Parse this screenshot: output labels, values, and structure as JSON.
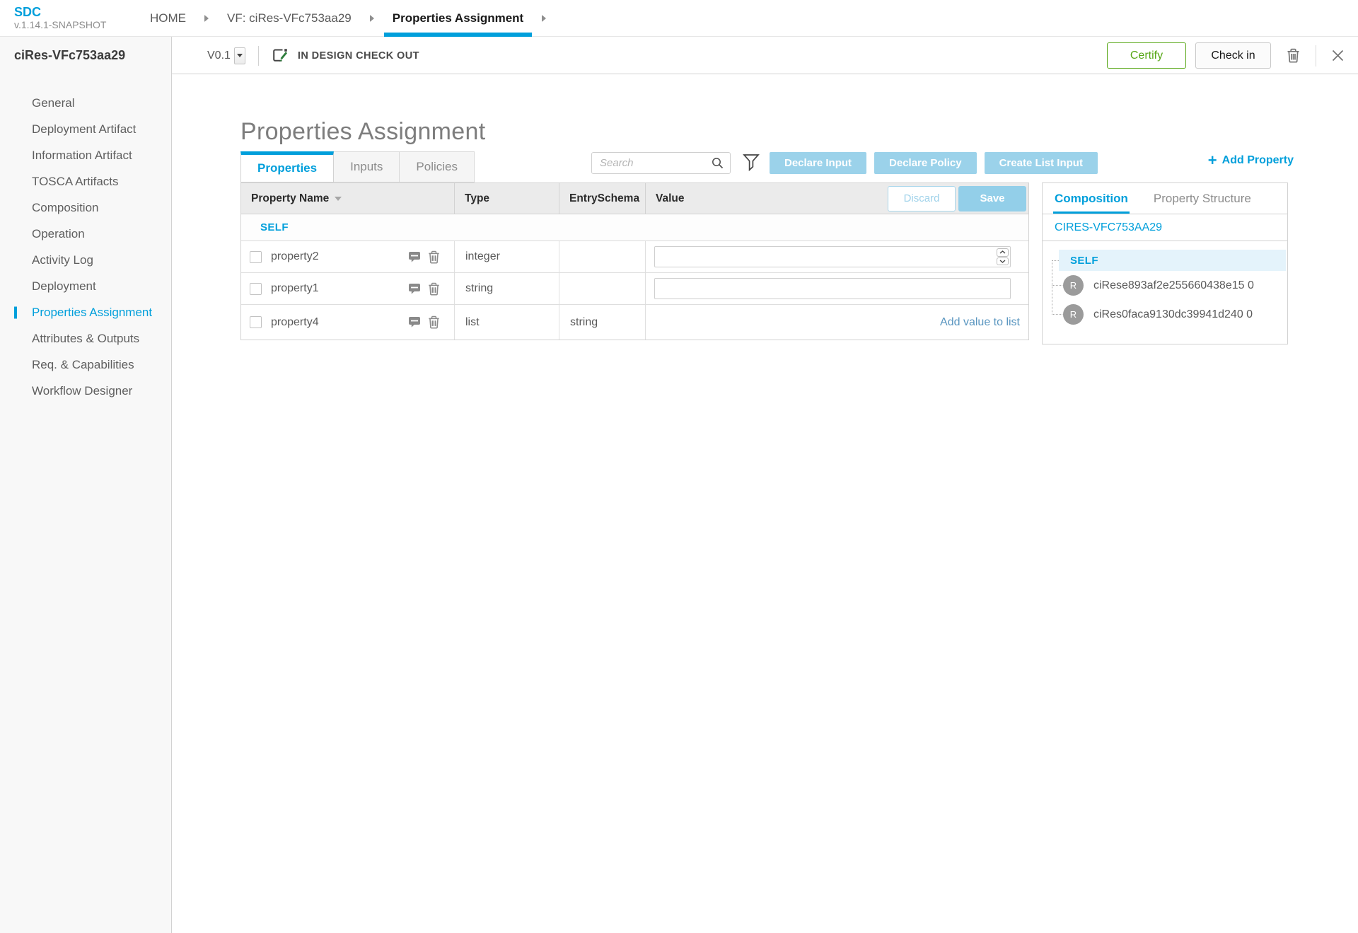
{
  "app": {
    "name": "SDC",
    "version": "v.1.14.1-SNAPSHOT"
  },
  "breadcrumb": {
    "items": [
      "HOME",
      "VF: ciRes-VFc753aa29",
      "Properties Assignment"
    ]
  },
  "workspace": {
    "component_name": "ciRes-VFc753aa29",
    "version": "V0.1",
    "state": "IN DESIGN CHECK OUT",
    "certify_label": "Certify",
    "check_in_label": "Check in"
  },
  "sidebar": {
    "active": "Properties Assignment",
    "items": [
      "General",
      "Deployment Artifact",
      "Information Artifact",
      "TOSCA Artifacts",
      "Composition",
      "Operation",
      "Activity Log",
      "Deployment",
      "Properties Assignment",
      "Attributes & Outputs",
      "Req. & Capabilities",
      "Workflow Designer"
    ]
  },
  "main": {
    "title": "Properties Assignment",
    "tabs": [
      "Properties",
      "Inputs",
      "Policies"
    ],
    "active_tab": "Properties",
    "search": {
      "placeholder": "Search",
      "value": ""
    },
    "actions": [
      "Declare Input",
      "Declare Policy",
      "Create List Input"
    ],
    "add_property": {
      "plus": "+",
      "label": "Add Property"
    },
    "table": {
      "columns": [
        "Property Name",
        "Type",
        "EntrySchema",
        "Value"
      ],
      "discard_label": "Discard",
      "save_label": "Save",
      "group_label": "SELF",
      "rows": [
        {
          "name": "property2",
          "type": "integer",
          "entry_schema": "",
          "value": "",
          "value_control": "number-input"
        },
        {
          "name": "property1",
          "type": "string",
          "entry_schema": "",
          "value": "",
          "value_control": "text-input"
        },
        {
          "name": "property4",
          "type": "list",
          "entry_schema": "string",
          "value_link": "Add value to list",
          "value_control": "link"
        }
      ]
    }
  },
  "composition_panel": {
    "tabs": [
      "Composition",
      "Property Structure"
    ],
    "active_tab": "Composition",
    "component": "CIRES-VFC753AA29",
    "tree": {
      "root": "SELF",
      "children": [
        {
          "avatar": "R",
          "label": "ciRese893af2e255660438e15 0"
        },
        {
          "avatar": "R",
          "label": "ciRes0faca9130dc39941d240 0"
        }
      ]
    }
  },
  "colors": {
    "accent": "#009fdb",
    "light_blue_button": "#9bd2ea",
    "certify_green": "#57a716",
    "selected_node_bg": "#e4f3fb",
    "avatar_gray": "#9b9b9b"
  }
}
